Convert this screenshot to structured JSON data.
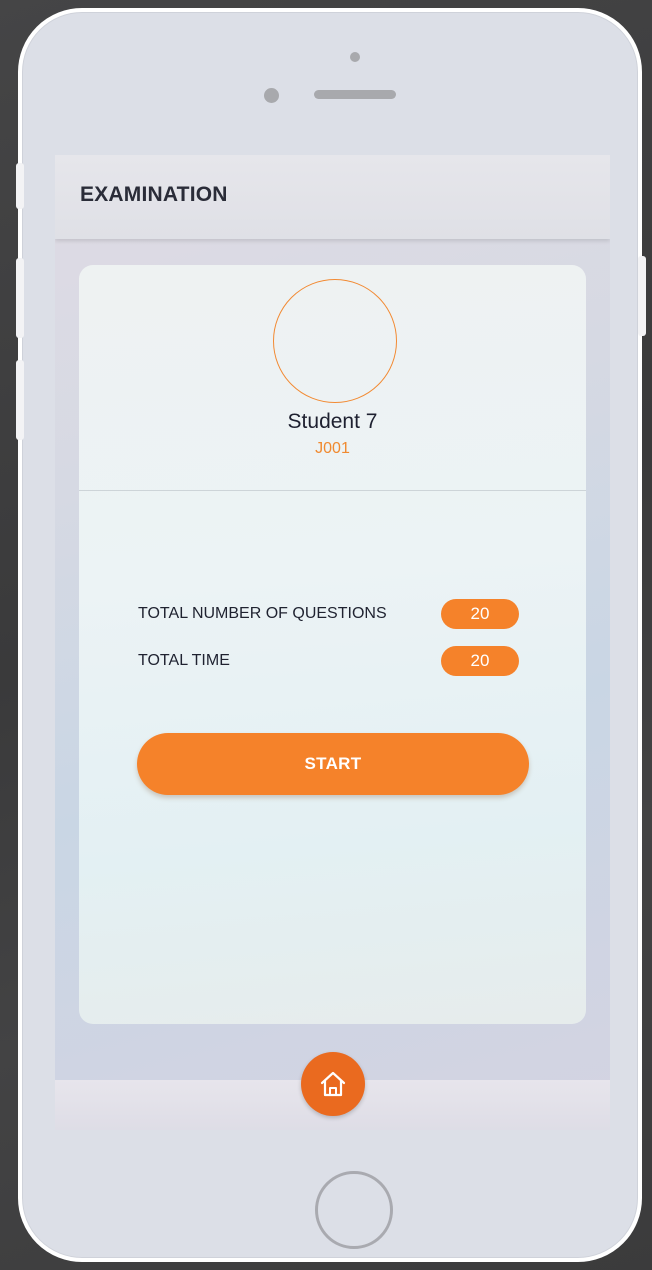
{
  "app_bar": {
    "title": "EXAMINATION"
  },
  "profile": {
    "name": "Student 7",
    "id": "J001"
  },
  "exam_info": {
    "questions_label": "TOTAL NUMBER OF QUESTIONS",
    "questions_value": "20",
    "time_label": "TOTAL TIME",
    "time_value": "20"
  },
  "actions": {
    "start_label": "START"
  },
  "bottom_nav": {
    "home_icon": "home-icon"
  },
  "colors": {
    "accent": "#f5822a",
    "home_button": "#ea6a1f",
    "title_text": "#2a2c38"
  }
}
